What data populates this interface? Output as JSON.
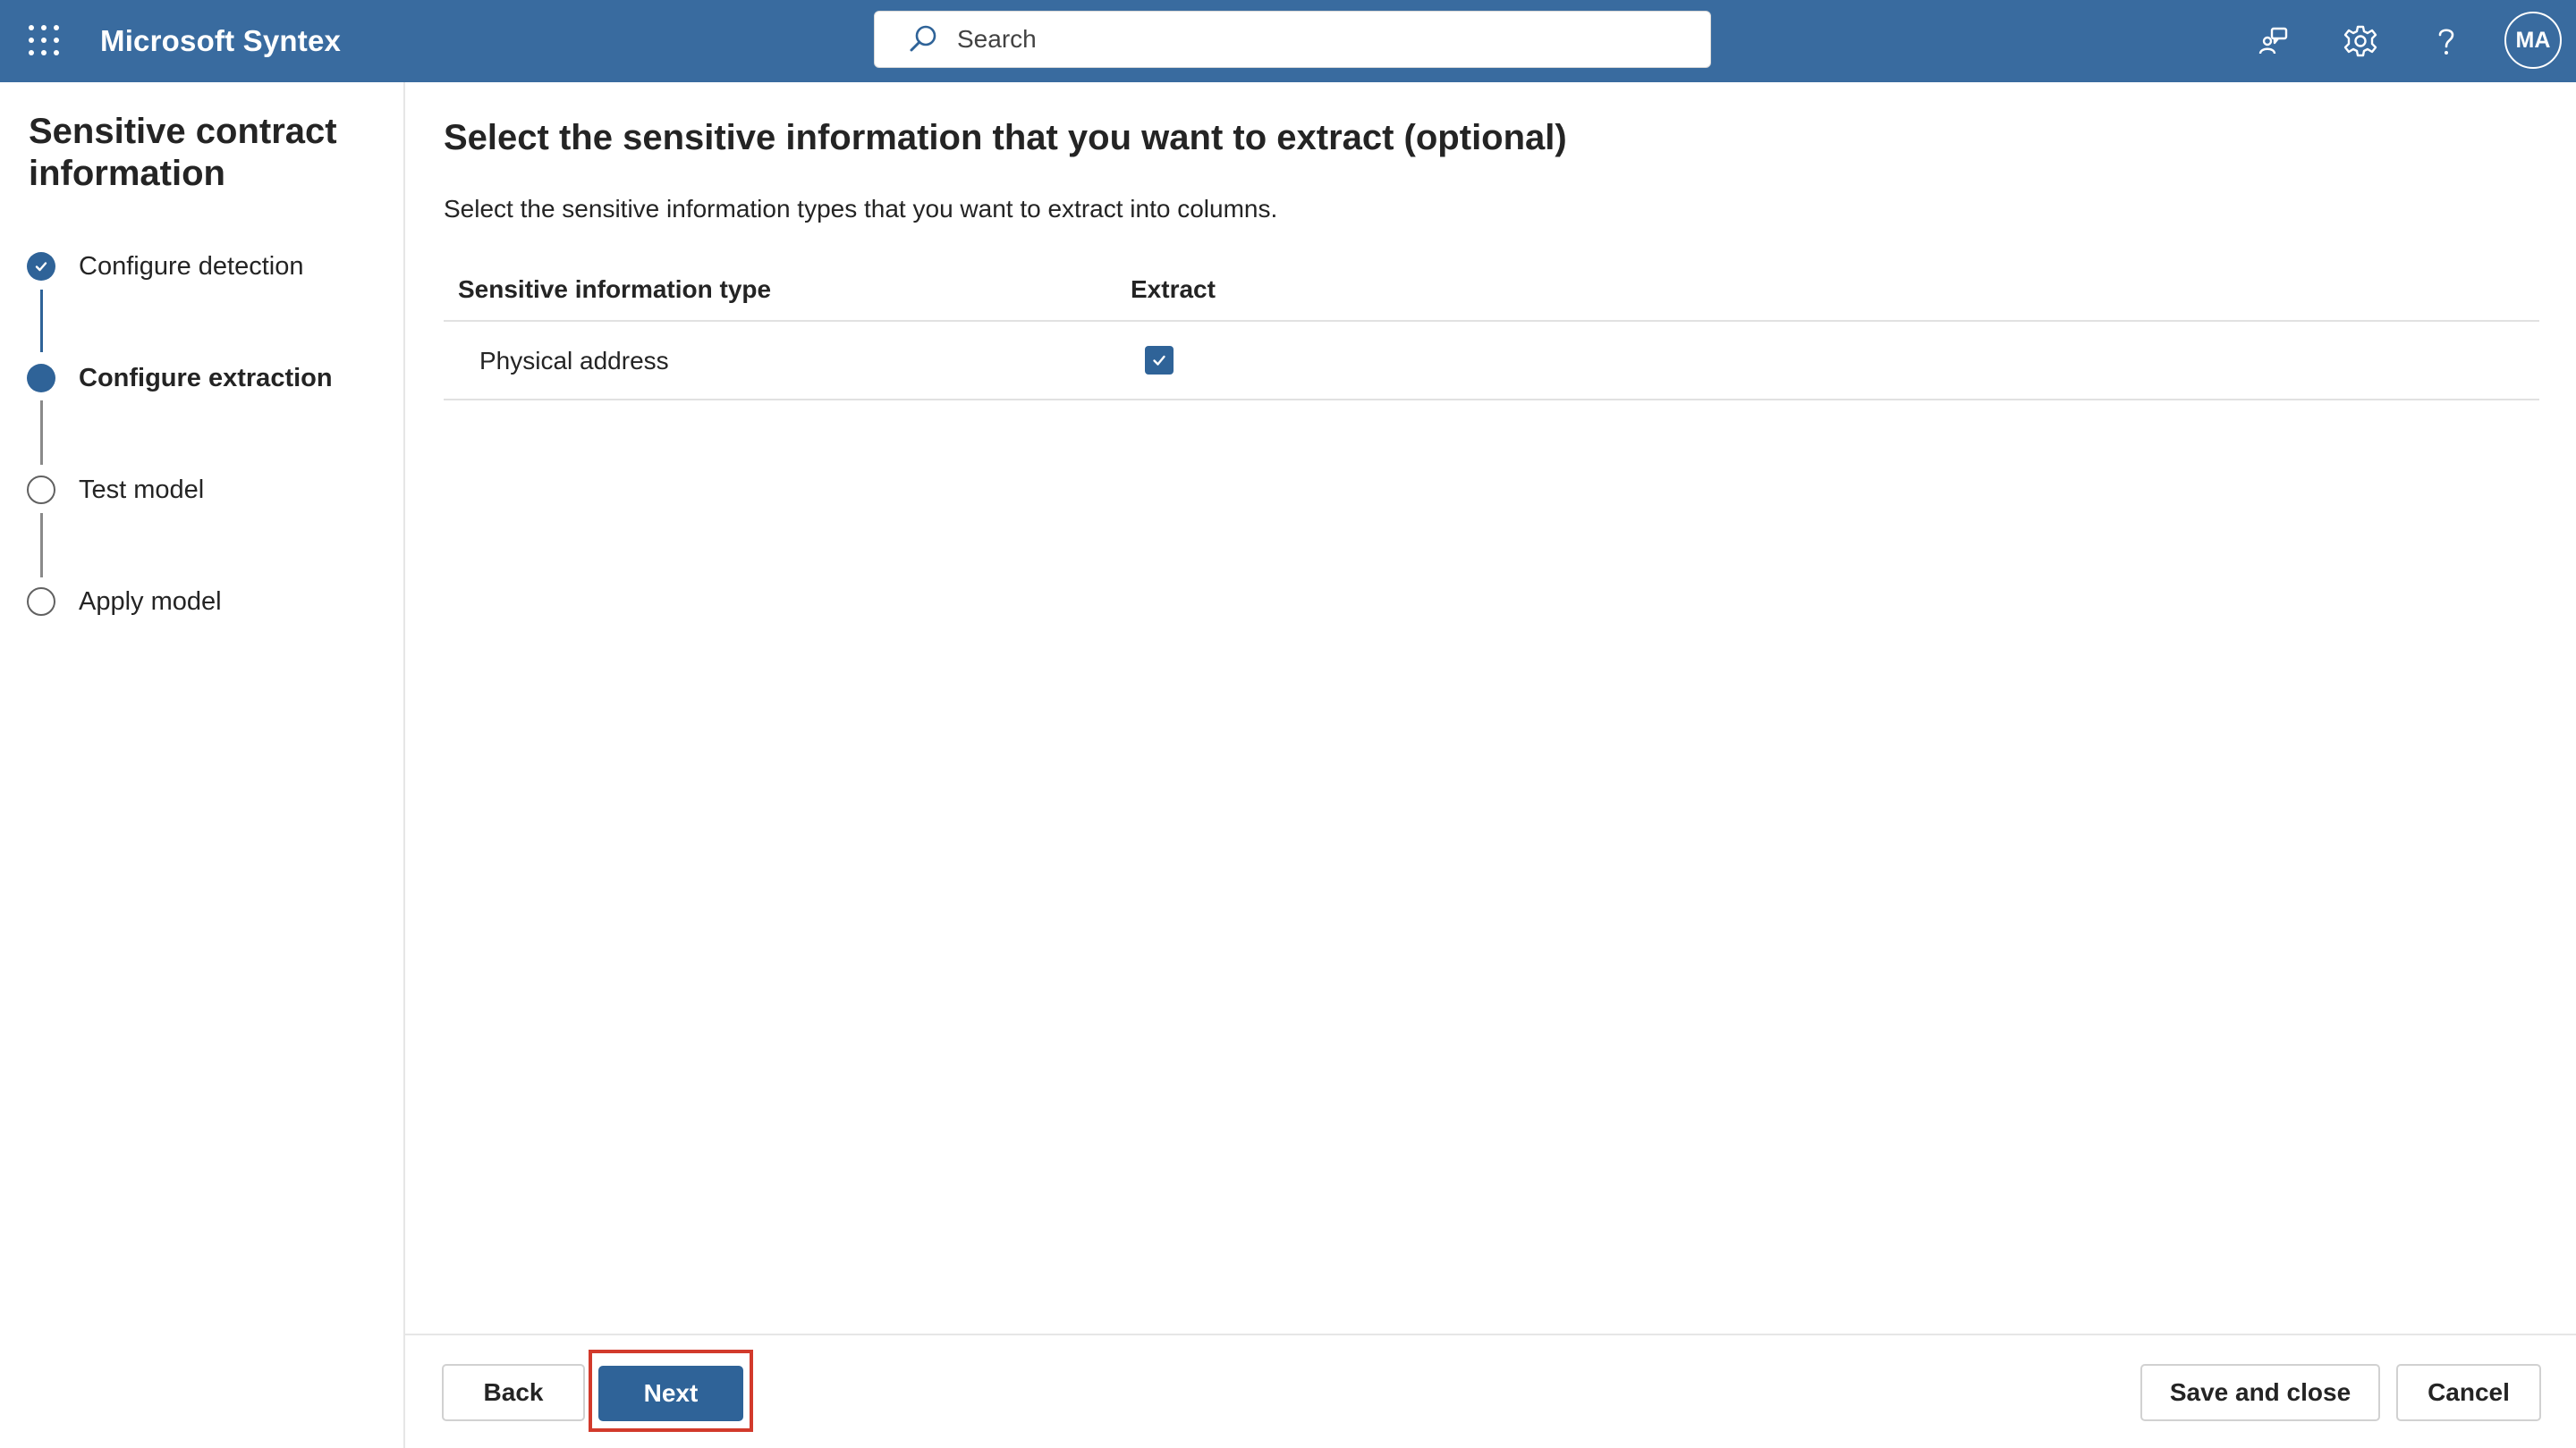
{
  "app": {
    "title": "Microsoft Syntex"
  },
  "search": {
    "placeholder": "Search"
  },
  "header_icons": [
    "waffle-icon",
    "feedback-icon",
    "settings-gear-icon",
    "help-icon"
  ],
  "user": {
    "initials": "MA"
  },
  "wizard": {
    "title": "Sensitive contract information",
    "steps": [
      {
        "label": "Configure detection",
        "state": "done"
      },
      {
        "label": "Configure extraction",
        "state": "current"
      },
      {
        "label": "Test model",
        "state": "todo"
      },
      {
        "label": "Apply model",
        "state": "todo"
      }
    ]
  },
  "main": {
    "title": "Select the sensitive information that you want to extract (optional)",
    "description": "Select the sensitive information types that you want to extract into columns.",
    "table": {
      "headers": [
        "Sensitive information type",
        "Extract"
      ],
      "rows": [
        {
          "type": "Physical address",
          "extract": true
        }
      ]
    }
  },
  "footer": {
    "back_label": "Back",
    "next_label": "Next",
    "save_close_label": "Save and close",
    "cancel_label": "Cancel"
  },
  "colors": {
    "topbar": "#396b9f",
    "accent": "#2f6398",
    "highlight": "#d23a2c"
  }
}
